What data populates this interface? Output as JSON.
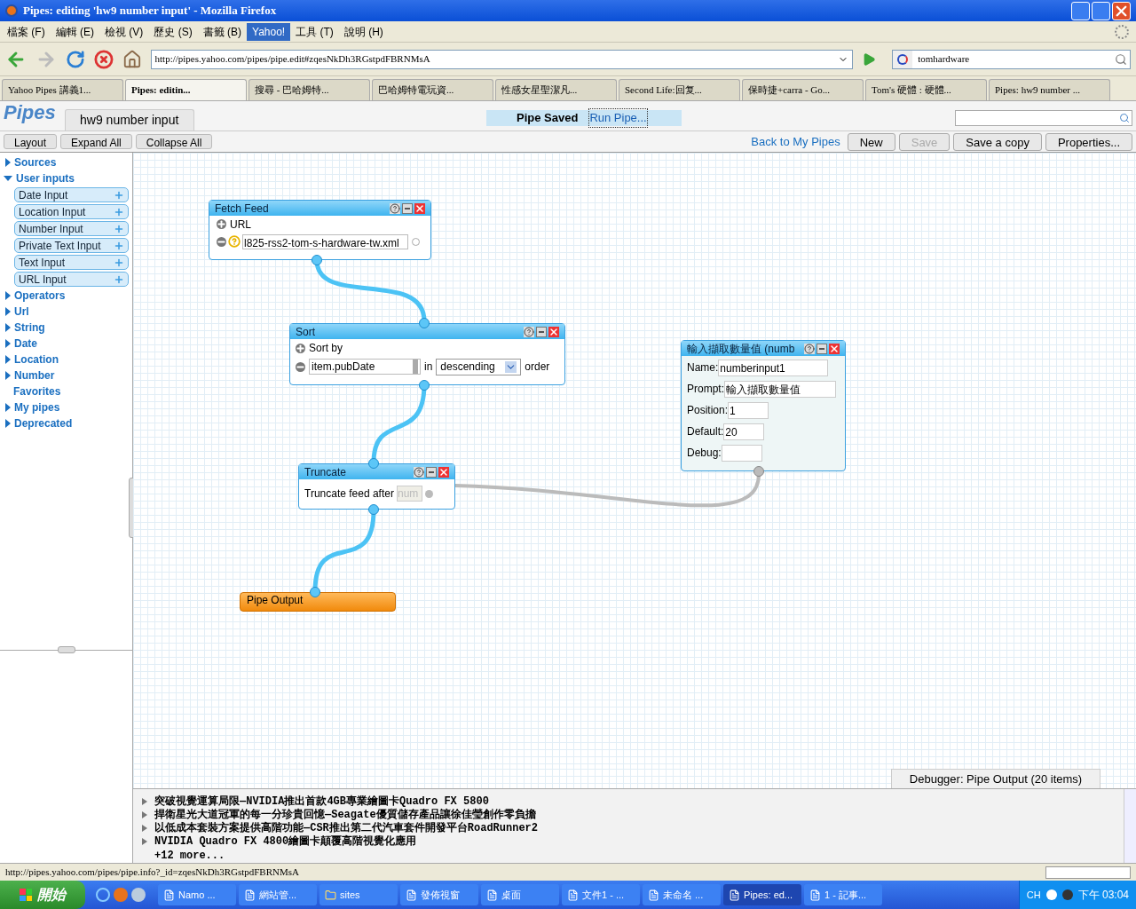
{
  "window": {
    "title": "Pipes: editing 'hw9 number input' - Mozilla Firefox"
  },
  "menu": [
    {
      "label": "檔案 (F)",
      "selected": false
    },
    {
      "label": "編輯 (E)",
      "selected": false
    },
    {
      "label": "檢視 (V)",
      "selected": false
    },
    {
      "label": "歷史 (S)",
      "selected": false
    },
    {
      "label": "書籤 (B)",
      "selected": false
    },
    {
      "label": "Yahoo!",
      "selected": true
    },
    {
      "label": "工具 (T)",
      "selected": false
    },
    {
      "label": "說明 (H)",
      "selected": false
    }
  ],
  "address": {
    "url": "http://pipes.yahoo.com/pipes/pipe.edit#zqesNkDh3RGstpdFBRNMsA"
  },
  "search": {
    "value": "tomhardware"
  },
  "tabs": [
    {
      "label": "Yahoo Pipes 講義1...",
      "selected": false
    },
    {
      "label": "Pipes: editin...",
      "selected": true
    },
    {
      "label": "搜尋 - 巴哈姆特...",
      "selected": false
    },
    {
      "label": "巴哈姆特電玩資...",
      "selected": false
    },
    {
      "label": "性感女星聖潔凡...",
      "selected": false
    },
    {
      "label": "Second Life:回复...",
      "selected": false
    },
    {
      "label": "保時捷+carra - Go...",
      "selected": false
    },
    {
      "label": "Tom's 硬體 : 硬體...",
      "selected": false
    },
    {
      "label": "Pipes: hw9 number ...",
      "selected": false
    }
  ],
  "pipes": {
    "logo": "Pipes",
    "pipe_name": "hw9 number input",
    "status": "Pipe Saved",
    "run_link": "Run Pipe..."
  },
  "toolbar_left": [
    "Layout",
    "Expand All",
    "Collapse All"
  ],
  "back_link": "Back to My Pipes",
  "buttons": [
    {
      "label": "New",
      "disabled": false
    },
    {
      "label": "Save",
      "disabled": true
    },
    {
      "label": "Save a copy",
      "disabled": false
    },
    {
      "label": "Properties...",
      "disabled": false
    }
  ],
  "sidebar": {
    "items": [
      {
        "label": "Sources",
        "expanded": false
      },
      {
        "label": "User inputs",
        "expanded": true,
        "children": [
          {
            "label": "Date Input"
          },
          {
            "label": "Location Input"
          },
          {
            "label": "Number Input"
          },
          {
            "label": "Private Text Input"
          },
          {
            "label": "Text Input"
          },
          {
            "label": "URL Input"
          }
        ]
      },
      {
        "label": "Operators",
        "expanded": false
      },
      {
        "label": "Url",
        "expanded": false
      },
      {
        "label": "String",
        "expanded": false
      },
      {
        "label": "Date",
        "expanded": false
      },
      {
        "label": "Location",
        "expanded": false
      },
      {
        "label": "Number",
        "expanded": false
      },
      {
        "label": "Favorites"
      },
      {
        "label": "My pipes",
        "expanded": false
      },
      {
        "label": "Deprecated",
        "expanded": false
      }
    ]
  },
  "modules": {
    "fetch_feed": {
      "title": "Fetch Feed",
      "url_label": "URL",
      "url_value": "l825-rss2-tom-s-hardware-tw.xml"
    },
    "sort": {
      "title": "Sort",
      "sort_by_label": "Sort by",
      "field": "item.pubDate",
      "in_label": "in",
      "order_value": "descending",
      "order_label": "order"
    },
    "truncate": {
      "title": "Truncate",
      "label": "Truncate feed after",
      "placeholder": "num"
    },
    "number_input": {
      "title": "輸入擷取數量值 (numb",
      "fields": [
        {
          "label": "Name:",
          "value": "numberinput1"
        },
        {
          "label": "Prompt:",
          "value": "輸入擷取數量值"
        },
        {
          "label": "Position:",
          "value": "1"
        },
        {
          "label": "Default:",
          "value": "20"
        },
        {
          "label": "Debug:"
        }
      ]
    },
    "pipe_output": {
      "title": "Pipe Output"
    }
  },
  "debugger": {
    "title": "Debugger: Pipe Output (20 items)",
    "items": [
      "突破視覺運算局限—NVIDIA推出首款4GB專業繪圖卡Quadro FX 5800",
      "捍衛星光大道冠軍的每一分珍貴回憶—Seagate優質儲存產品讓徐佳瑩創作零負擔",
      "以低成本套裝方案提供高階功能—CSR推出第二代汽車套件開發平台RoadRunner2",
      "NVIDIA Quadro FX 4800繪圖卡顛覆高階視覺化應用"
    ],
    "more": "+12 more..."
  },
  "status_bar": {
    "url": "http://pipes.yahoo.com/pipes/pipe.info?_id=zqesNkDh3RGstpdFBRNMsA"
  },
  "taskbar": {
    "start": "開始",
    "items": [
      {
        "label": "Namo ...",
        "selected": false
      },
      {
        "label": "網站管...",
        "selected": false
      },
      {
        "label": "sites",
        "selected": false
      },
      {
        "label": "發佈視窗",
        "selected": false
      },
      {
        "label": "桌面",
        "selected": false
      },
      {
        "label": "文件1 - ...",
        "selected": false
      },
      {
        "label": "未命名 ...",
        "selected": false
      },
      {
        "label": "Pipes: ed...",
        "selected": true
      },
      {
        "label": "1 - 記事...",
        "selected": false
      }
    ],
    "language": "CH",
    "clock": "下午 03:04"
  }
}
